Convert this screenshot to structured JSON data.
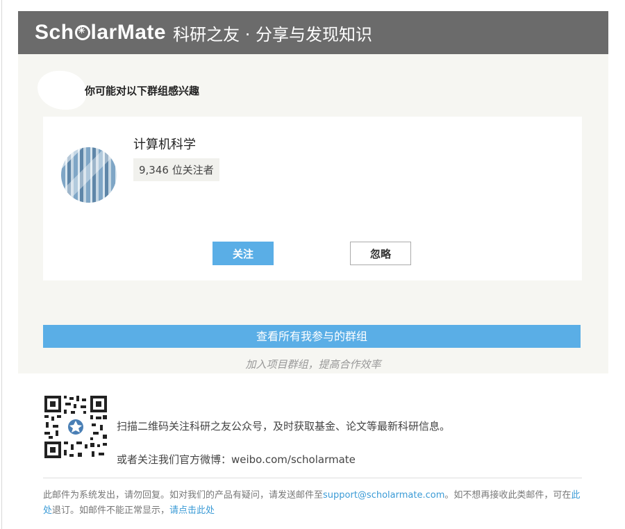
{
  "header": {
    "logo_prefix": "Sch",
    "logo_suffix": "larMate",
    "tagline": "科研之友 · 分享与发现知识"
  },
  "main": {
    "heading": "你可能对以下群组感兴趣",
    "group": {
      "name": "计算机科学",
      "followers": "9,346 位关注者"
    },
    "follow_label": "关注",
    "ignore_label": "忽略",
    "view_all_label": "查看所有我参与的群组",
    "slogan": "加入项目群组，提高合作效率"
  },
  "qr_section": {
    "line1": "扫描二维码关注科研之友公众号，及时获取基金、论文等最新科研信息。",
    "line2": "或者关注我们官方微博：weibo.com/scholarmate"
  },
  "footer": {
    "text1": "此邮件为系统发出，请勿回复。如对我们的产品有疑问，请发送邮件至",
    "email": "support@scholarmate.com",
    "text2": "。如不想再接收此类邮件，可在",
    "unsubscribe_link": "此处",
    "text3": "退订。如邮件不能正常显示，",
    "view_link": "请点击此处"
  },
  "colors": {
    "header_bg": "#6b6b6b",
    "accent": "#5aaee6",
    "panel_bg": "#f6f6f2"
  }
}
